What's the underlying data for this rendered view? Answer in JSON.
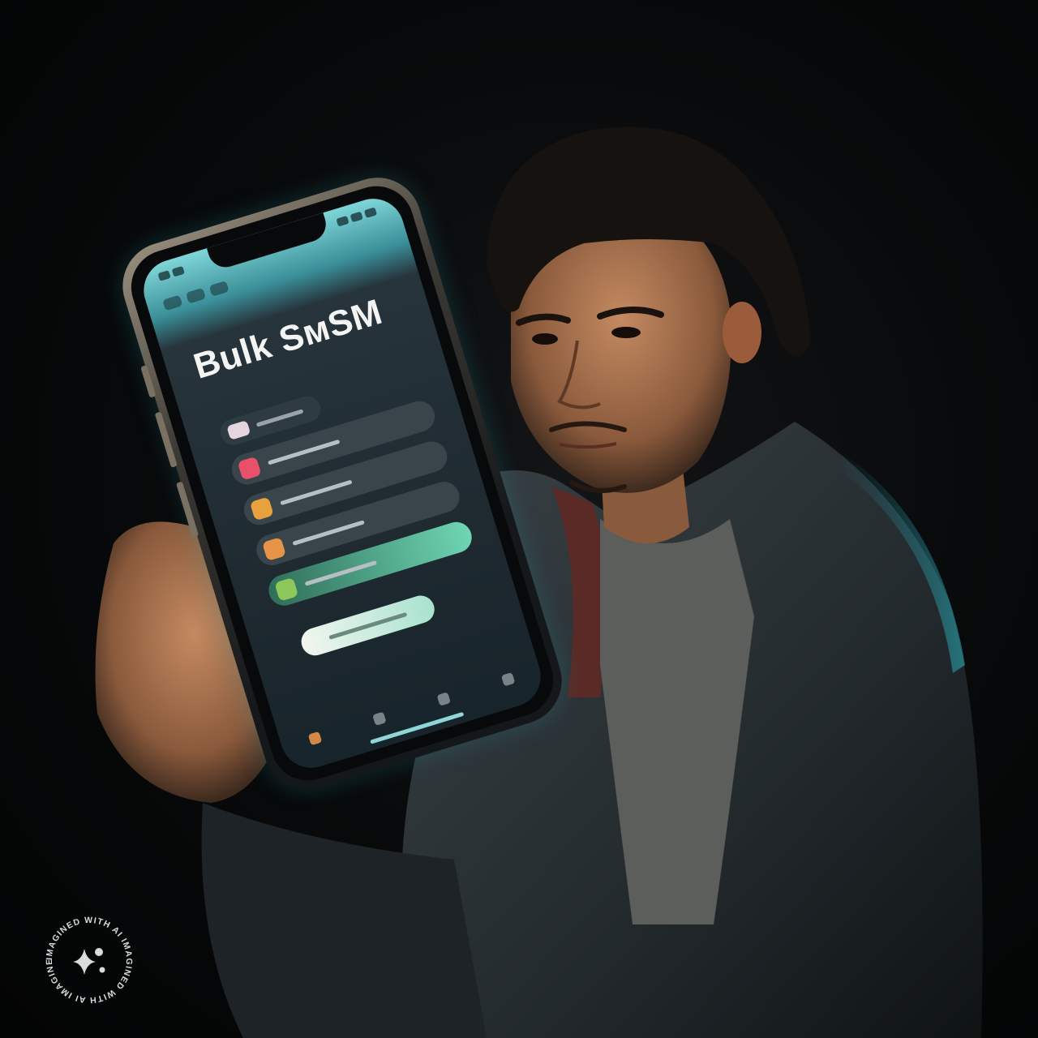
{
  "scene": {
    "subject": "man-holding-phone",
    "palette": {
      "background": "#050606",
      "rim_light": "#2aa7b3",
      "skin": "#b97f58",
      "hoodie": "#2c3236",
      "shirt": "#5c5f5c"
    }
  },
  "phone_app": {
    "title": "Bulk SᴍSM",
    "rows": [
      {
        "icon": "pink-app-icon",
        "color": "#e9516a"
      },
      {
        "icon": "amber-app-icon",
        "color": "#e8a13c"
      },
      {
        "icon": "orange-app-icon",
        "color": "#e89448"
      },
      {
        "icon": "green-app-icon",
        "color": "#8ec85a",
        "active": true
      }
    ]
  },
  "watermark": {
    "text": "IMAGINED WITH AI IMAGINED WITH AI IMAGINED WITH AI",
    "icon": "sparkle-icon"
  }
}
